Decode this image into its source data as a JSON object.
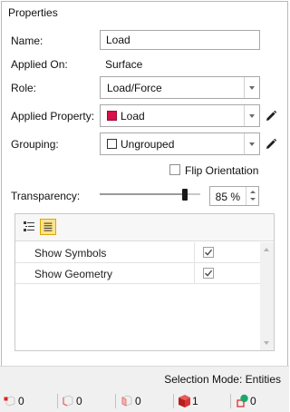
{
  "panel": {
    "title": "Properties"
  },
  "fields": {
    "name_label": "Name:",
    "name_value": "Load",
    "applied_on_label": "Applied On:",
    "applied_on_value": "Surface",
    "role_label": "Role:",
    "role_value": "Load/Force",
    "applied_property_label": "Applied Property:",
    "applied_property_value": "Load",
    "applied_property_color": "#d80f4a",
    "grouping_label": "Grouping:",
    "grouping_value": "Ungrouped",
    "flip_orientation_label": "Flip Orientation",
    "flip_orientation_checked": false,
    "transparency_label": "Transparency:",
    "transparency_value": "85 %",
    "transparency_level": 0.85
  },
  "grid": {
    "toolbar": {
      "categorized_icon": "categorized-icon",
      "alphabetical_icon": "alphabetical-icon",
      "active": "alphabetical"
    },
    "rows": [
      {
        "name": "Show Symbols",
        "checked": true
      },
      {
        "name": "Show Geometry",
        "checked": true
      }
    ]
  },
  "status": {
    "selection_mode": "Selection Mode: Entities",
    "counts": [
      {
        "icon": "vertex-selection-icon",
        "value": "0"
      },
      {
        "icon": "edge-selection-icon",
        "value": "0"
      },
      {
        "icon": "face-selection-icon",
        "value": "0"
      },
      {
        "icon": "solid-selection-icon",
        "value": "1"
      },
      {
        "icon": "node-selection-icon",
        "value": "0"
      }
    ]
  },
  "colors": {
    "accent_red": "#d80f4a",
    "toolbar_active": "#fde38a",
    "node_green": "#1aa86a"
  }
}
